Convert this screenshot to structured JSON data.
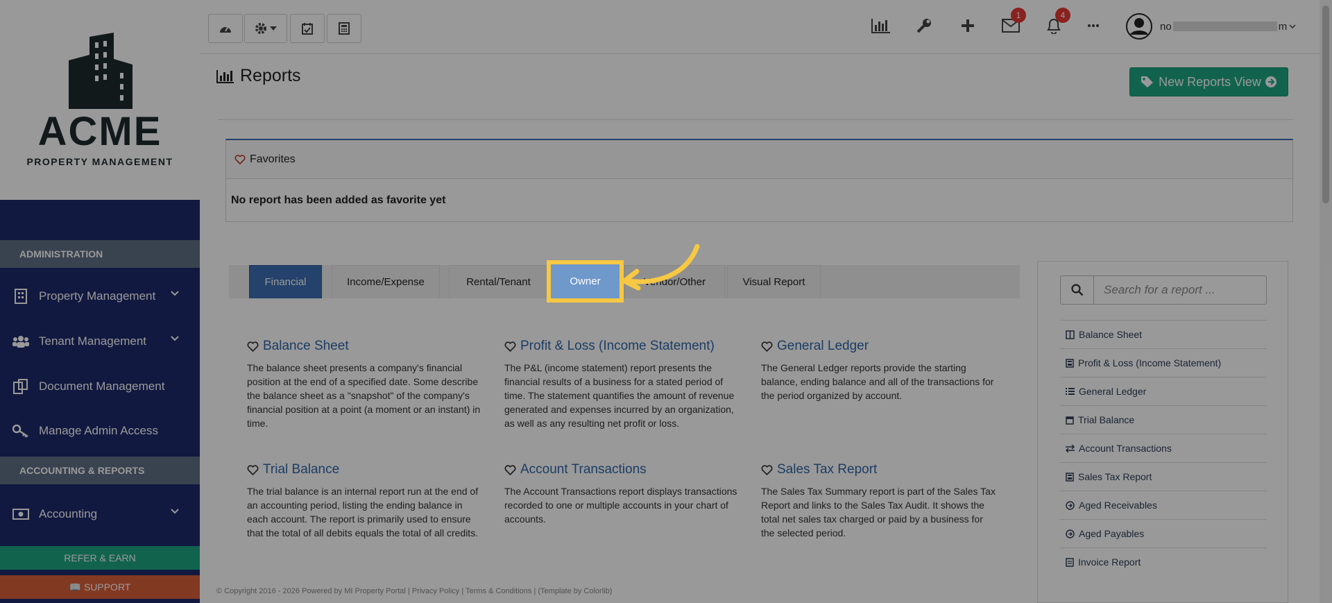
{
  "brand": {
    "name": "ACME",
    "subtitle": "PROPERTY MANAGEMENT"
  },
  "sidebar": {
    "sections": [
      "ADMINISTRATION",
      "ACCOUNTING & REPORTS"
    ],
    "items": [
      {
        "label": "Property Management",
        "icon": "building-icon"
      },
      {
        "label": "Tenant Management",
        "icon": "users-icon"
      },
      {
        "label": "Document Management",
        "icon": "documents-icon"
      },
      {
        "label": "Manage Admin Access",
        "icon": "key-icon"
      },
      {
        "label": "Accounting",
        "icon": "money-icon"
      }
    ],
    "refer_label": "REFER & EARN",
    "support_label": "SUPPORT"
  },
  "topbar": {
    "mail_count": "1",
    "notif_count": "4",
    "user_prefix": "no",
    "user_suffix": "m"
  },
  "page": {
    "title": "Reports",
    "new_view_label": "New Reports View"
  },
  "favorites": {
    "title": "Favorites",
    "empty": "No report has been added as favorite yet"
  },
  "tabs": [
    "Financial",
    "Income/Expense",
    "Rental/Tenant",
    "Owner",
    "Vendor/Other",
    "Visual Report"
  ],
  "reports": [
    {
      "title": "Balance Sheet",
      "desc": "The balance sheet presents a company's financial position at the end of a specified date. Some describe the balance sheet as a \"snapshot\" of the company's financial position at a point (a moment or an instant) in time."
    },
    {
      "title": "Profit & Loss (Income Statement)",
      "desc": "The P&L (income statement) report presents the financial results of a business for a stated period of time. The statement quantifies the amount of revenue generated and expenses incurred by an organization, as well as any resulting net profit or loss."
    },
    {
      "title": "General Ledger",
      "desc": "The General Ledger reports provide the starting balance, ending balance and all of the transactions for the period organized by account."
    },
    {
      "title": "Trial Balance",
      "desc": "The trial balance is an internal report run at the end of an accounting period, listing the ending balance in each account. The report is primarily used to ensure that the total of all debits equals the total of all credits."
    },
    {
      "title": "Account Transactions",
      "desc": "The Account Transactions report displays transactions recorded to one or multiple accounts in your chart of accounts."
    },
    {
      "title": "Sales Tax Report",
      "desc": "The Sales Tax Summary report is part of the Sales Tax Report and links to the Sales Tax Audit. It shows the total net sales tax charged or paid by a business for the selected period."
    }
  ],
  "search": {
    "placeholder": "Search for a report ..."
  },
  "quick_list": [
    {
      "label": "Balance Sheet",
      "icon": "columns-icon"
    },
    {
      "label": "Profit & Loss (Income Statement)",
      "icon": "calculator-icon"
    },
    {
      "label": "General Ledger",
      "icon": "list-icon"
    },
    {
      "label": "Trial Balance",
      "icon": "calendar-icon"
    },
    {
      "label": "Account Transactions",
      "icon": "exchange-icon"
    },
    {
      "label": "Sales Tax Report",
      "icon": "calculator-icon"
    },
    {
      "label": "Aged Receivables",
      "icon": "arrow-circle-icon"
    },
    {
      "label": "Aged Payables",
      "icon": "arrow-circle-icon"
    },
    {
      "label": "Invoice Report",
      "icon": "invoice-icon"
    }
  ],
  "footer": {
    "text": "© Copyright 2016 - 2026 Powered by MI Property Portal | Privacy Policy | Terms & Conditions | (Template by Colorlib)"
  },
  "colors": {
    "accent": "#3c6fb3",
    "nav": "#1d2b6b",
    "green": "#1ea583",
    "highlight": "#f7c843"
  }
}
